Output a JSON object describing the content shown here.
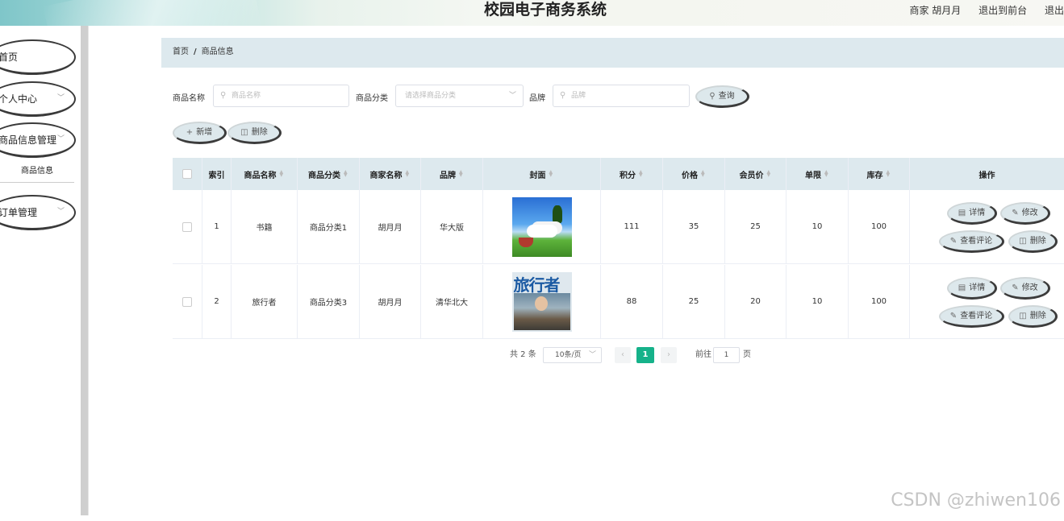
{
  "header": {
    "title": "校园电子商务系统",
    "user": "商家 胡月月",
    "back_front": "退出到前台",
    "logout": "退出"
  },
  "sidebar": {
    "items": [
      {
        "label": "首页"
      },
      {
        "label": "个人中心"
      },
      {
        "label": "商品信息管理"
      },
      {
        "label": "订单管理"
      }
    ],
    "submenu": "商品信息"
  },
  "breadcrumb": {
    "home": "首页",
    "separator": "/",
    "current": "商品信息"
  },
  "search": {
    "name_label": "商品名称",
    "name_placeholder": "商品名称",
    "category_label": "商品分类",
    "category_placeholder": "请选择商品分类",
    "brand_label": "品牌",
    "brand_placeholder": "品牌",
    "query_button": "查询"
  },
  "actions": {
    "add": "新增",
    "delete": "删除"
  },
  "table": {
    "columns": [
      "索引",
      "商品名称",
      "商品分类",
      "商家名称",
      "品牌",
      "封面",
      "积分",
      "价格",
      "会员价",
      "单限",
      "库存",
      "操作"
    ],
    "rows": [
      {
        "index": "1",
        "name": "书籍",
        "category": "商品分类1",
        "merchant": "胡月月",
        "brand": "华大版",
        "points": "111",
        "price": "35",
        "member_price": "25",
        "limit": "10",
        "stock": "100",
        "cover_icon": "nature-landscape-image"
      },
      {
        "index": "2",
        "name": "旅行者",
        "category": "商品分类3",
        "merchant": "胡月月",
        "brand": "清华北大",
        "points": "88",
        "price": "25",
        "member_price": "20",
        "limit": "10",
        "stock": "100",
        "cover_icon": "magazine-cover-image",
        "cover_text": "旅行者"
      }
    ],
    "op_labels": {
      "detail": "详情",
      "edit": "修改",
      "comments": "查看评论",
      "delete": "删除"
    }
  },
  "pagination": {
    "total": "共 2 条",
    "page_size": "10条/页",
    "current_page": "1",
    "goto_label": "前往",
    "goto_value": "1",
    "page_suffix": "页"
  },
  "watermark": "CSDN @zhiwen106",
  "colors": {
    "accent": "#16b28a",
    "header_bg": "#dde9ee"
  }
}
